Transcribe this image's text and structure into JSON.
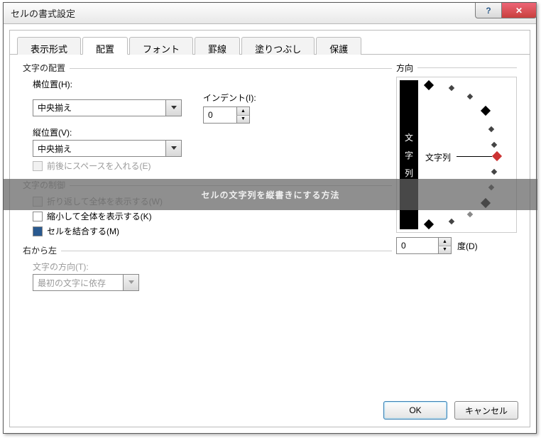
{
  "title": "セルの書式設定",
  "tabs": [
    "表示形式",
    "配置",
    "フォント",
    "罫線",
    "塗りつぶし",
    "保護"
  ],
  "activeTab": 1,
  "align": {
    "header": "文字の配置",
    "hLabel": "横位置(H):",
    "hValue": "中央揃え",
    "vLabel": "縦位置(V):",
    "vValue": "中央揃え",
    "indentLabel": "インデント(I):",
    "indentValue": "0",
    "spaceLabel": "前後にスペースを入れる(E)"
  },
  "control": {
    "header": "文字の制御",
    "wrap": "折り返して全体を表示する(W)",
    "shrink": "縮小して全体を表示する(K)",
    "merge": "セルを結合する(M)"
  },
  "rtl": {
    "header": "右から左",
    "dirLabel": "文字の方向(T):",
    "dirValue": "最初の文字に依存"
  },
  "orient": {
    "header": "方向",
    "vertText": "文字列",
    "gaugeText": "文字列",
    "degValue": "0",
    "degLabel": "度(D)"
  },
  "buttons": {
    "ok": "OK",
    "cancel": "キャンセル"
  },
  "overlay": "セルの文字列を縦書きにする方法",
  "colors": {
    "accent": "#29598f",
    "danger": "#c8403d"
  }
}
